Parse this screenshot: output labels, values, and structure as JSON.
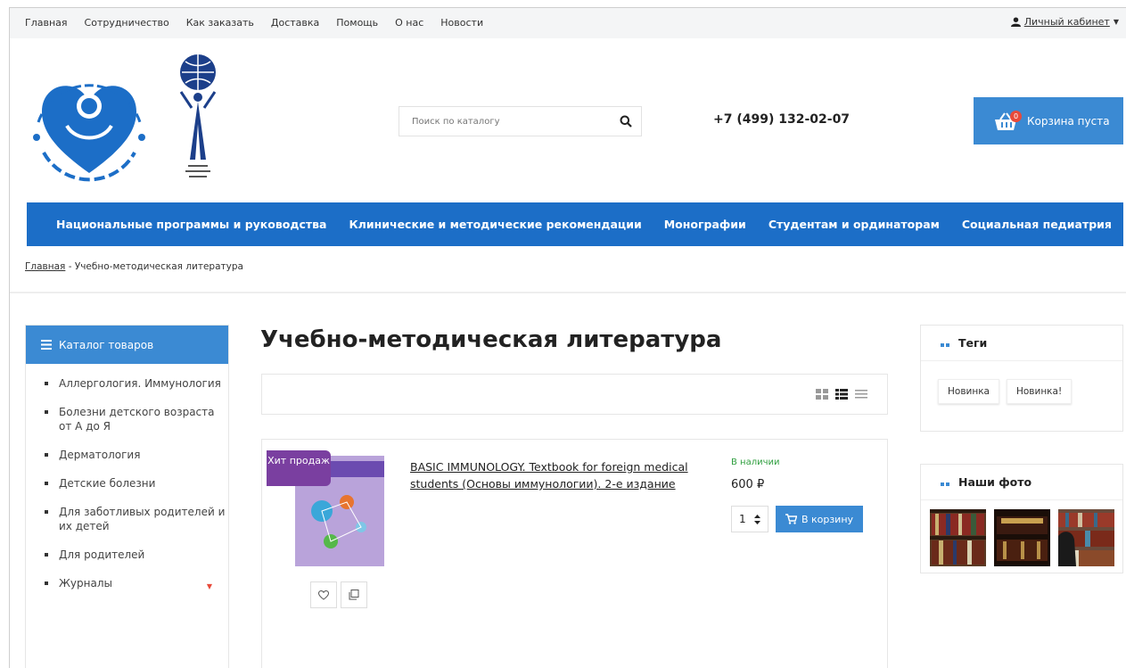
{
  "topbar": {
    "links": [
      "Главная",
      "Сотрудничество",
      "Как заказать",
      "Доставка",
      "Помощь",
      "О нас",
      "Новости"
    ],
    "account_label": "Личный кабинет"
  },
  "header": {
    "search_placeholder": "Поиск по каталогу",
    "phone": "+7 (499) 132-02-07",
    "cart_label": "Корзина пуста",
    "cart_count": "0"
  },
  "mainnav": {
    "items": [
      "Национальные программы и руководства",
      "Клинические и методические рекомендации",
      "Монографии",
      "Студентам и ординаторам",
      "Социальная педиатрия"
    ],
    "more": "●●●"
  },
  "breadcrumb": {
    "home": "Главная",
    "separator": " - ",
    "current": "Учебно-методическая литература"
  },
  "sidebar": {
    "title": "Каталог товаров",
    "items": [
      "Аллергология. Иммунология",
      "Болезни детского возраста от А до Я",
      "Дерматология",
      "Детские болезни",
      "Для заботливых родителей и их детей",
      "Для родителей",
      "Журналы"
    ]
  },
  "main": {
    "title": "Учебно-методическая литература",
    "product": {
      "badge": "Хит продаж",
      "title": "BASIC IMMUNOLOGY. Textbook for foreign medical students (Основы иммунологии). 2-е издание",
      "stock": "В наличии",
      "price": "600 ₽",
      "qty": "1",
      "buy_label": "В корзину"
    }
  },
  "tags_widget": {
    "title": "Теги",
    "tags": [
      "Новинка",
      "Новинка!"
    ]
  },
  "photos_widget": {
    "title": "Наши фото"
  },
  "colors": {
    "accent": "#3b8ad3",
    "nav": "#1c6ec7",
    "badge": "#7a3fa0",
    "stock": "#2e9e3e"
  }
}
